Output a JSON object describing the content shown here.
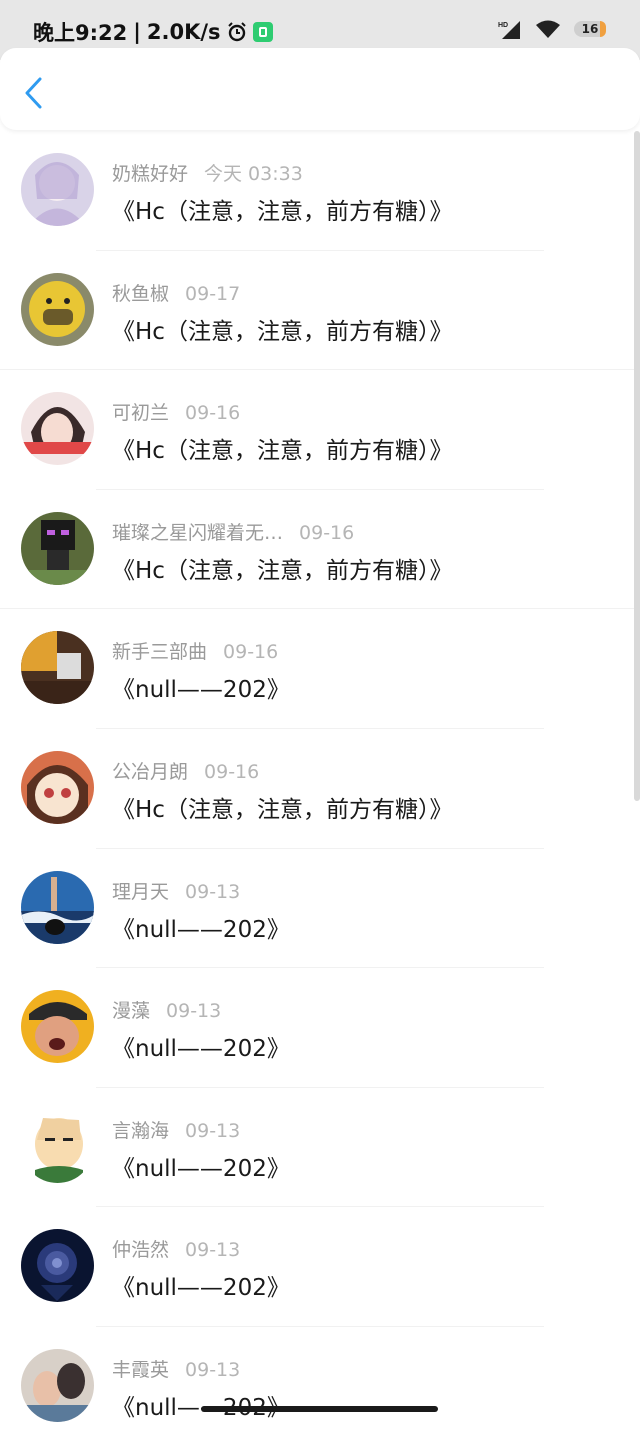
{
  "status_bar": {
    "time": "晚上9:22",
    "speed": "2.0K/s",
    "battery": "16"
  },
  "messages": [
    {
      "name": "奶糕好好",
      "time": "今天 03:33",
      "title": "《Hc（注意，注意，前方有糖）》"
    },
    {
      "name": "秋鱼椒",
      "time": "09-17",
      "title": "《Hc（注意，注意，前方有糖）》"
    },
    {
      "name": "可初兰",
      "time": "09-16",
      "title": "《Hc（注意，注意，前方有糖）》"
    },
    {
      "name": "璀璨之星闪耀着无…",
      "time": "09-16",
      "title": "《Hc（注意，注意，前方有糖）》"
    },
    {
      "name": "新手三部曲",
      "time": "09-16",
      "title": "《null——202》"
    },
    {
      "name": "公冶月朗",
      "time": "09-16",
      "title": "《Hc（注意，注意，前方有糖）》"
    },
    {
      "name": "理月天",
      "time": "09-13",
      "title": "《null——202》"
    },
    {
      "name": "漫藻",
      "time": "09-13",
      "title": "《null——202》"
    },
    {
      "name": "言瀚海",
      "time": "09-13",
      "title": "《null——202》"
    },
    {
      "name": "仲浩然",
      "time": "09-13",
      "title": "《null——202》"
    },
    {
      "name": "丰霞英",
      "time": "09-13",
      "title": "《null——202》"
    }
  ],
  "colors": {
    "accent": "#2f9bf0",
    "name_text": "#9a9a9a",
    "time_text": "#b5b5b5",
    "title_text": "#1a1a1a"
  }
}
